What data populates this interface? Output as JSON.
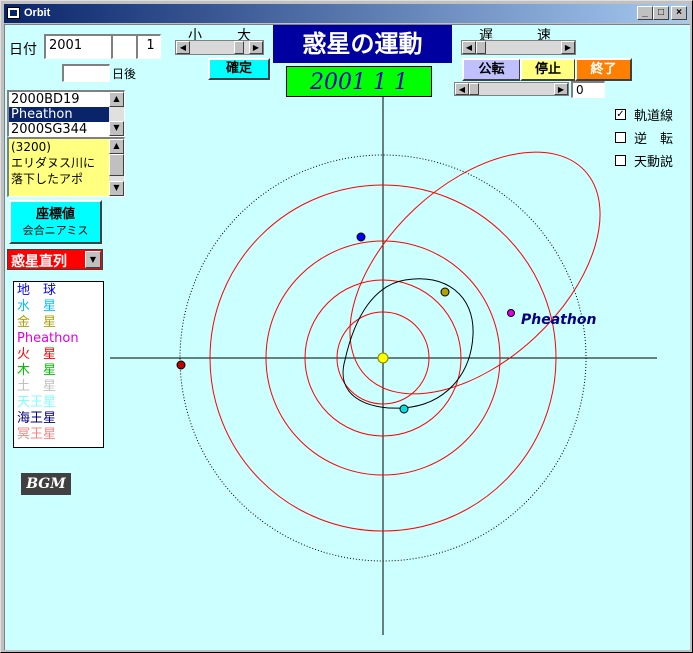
{
  "window": {
    "title": "Orbit",
    "min": "_",
    "max": "□",
    "close": "×"
  },
  "date": {
    "label": "日付",
    "year": "2001",
    "month": "",
    "day": "1",
    "after_value": "",
    "after_label": "日後"
  },
  "size": {
    "small": "小",
    "large": "大",
    "confirm": "確定"
  },
  "heading": "惑星の運動",
  "date_display": "2001  1  1",
  "speed": {
    "slow": "遅",
    "fast": "速",
    "counter": "0"
  },
  "buttons": {
    "revolve": "公転",
    "stop": "停止",
    "quit": "終了"
  },
  "asteroids": [
    "2000BD19",
    "Pheathon",
    "2000SG344"
  ],
  "asteroid_selected": 1,
  "description": [
    "(3200)",
    "エリダヌス川に",
    "落下したアポ"
  ],
  "coord_button": {
    "line1": "座標値",
    "line2": "会合ニアミス"
  },
  "mode_select": {
    "value": "惑星直列"
  },
  "legend": [
    {
      "name": "地　球",
      "color": "#0000ff"
    },
    {
      "name": "水　星",
      "color": "#00c0ff"
    },
    {
      "name": "金　星",
      "color": "#b0a000"
    },
    {
      "name": "Pheathon",
      "color": "#e000e0"
    },
    {
      "name": "火　星",
      "color": "#ff0000"
    },
    {
      "name": "木　星",
      "color": "#00c000"
    },
    {
      "name": "土　星",
      "color": "#c0c0c0"
    },
    {
      "name": "天王星",
      "color": "#80ffff"
    },
    {
      "name": "海王星",
      "color": "#000080"
    },
    {
      "name": "冥王星",
      "color": "#ff8080"
    }
  ],
  "options": [
    {
      "label": "軌道線",
      "checked": true
    },
    {
      "label": "逆　転",
      "checked": false
    },
    {
      "label": "天動説",
      "checked": false
    }
  ],
  "bgm": "BGM",
  "orbit_label": "Pheathon",
  "colors": {
    "accent": "#0000a0",
    "date_bg": "#00ff00",
    "quit_bg": "#ff8000",
    "stop_bg": "#ffff80",
    "revolve_bg": "#c0c0ff",
    "confirm_bg": "#00ffff",
    "coord_bg": "#00ffff",
    "mode_bg": "#ff0000"
  }
}
